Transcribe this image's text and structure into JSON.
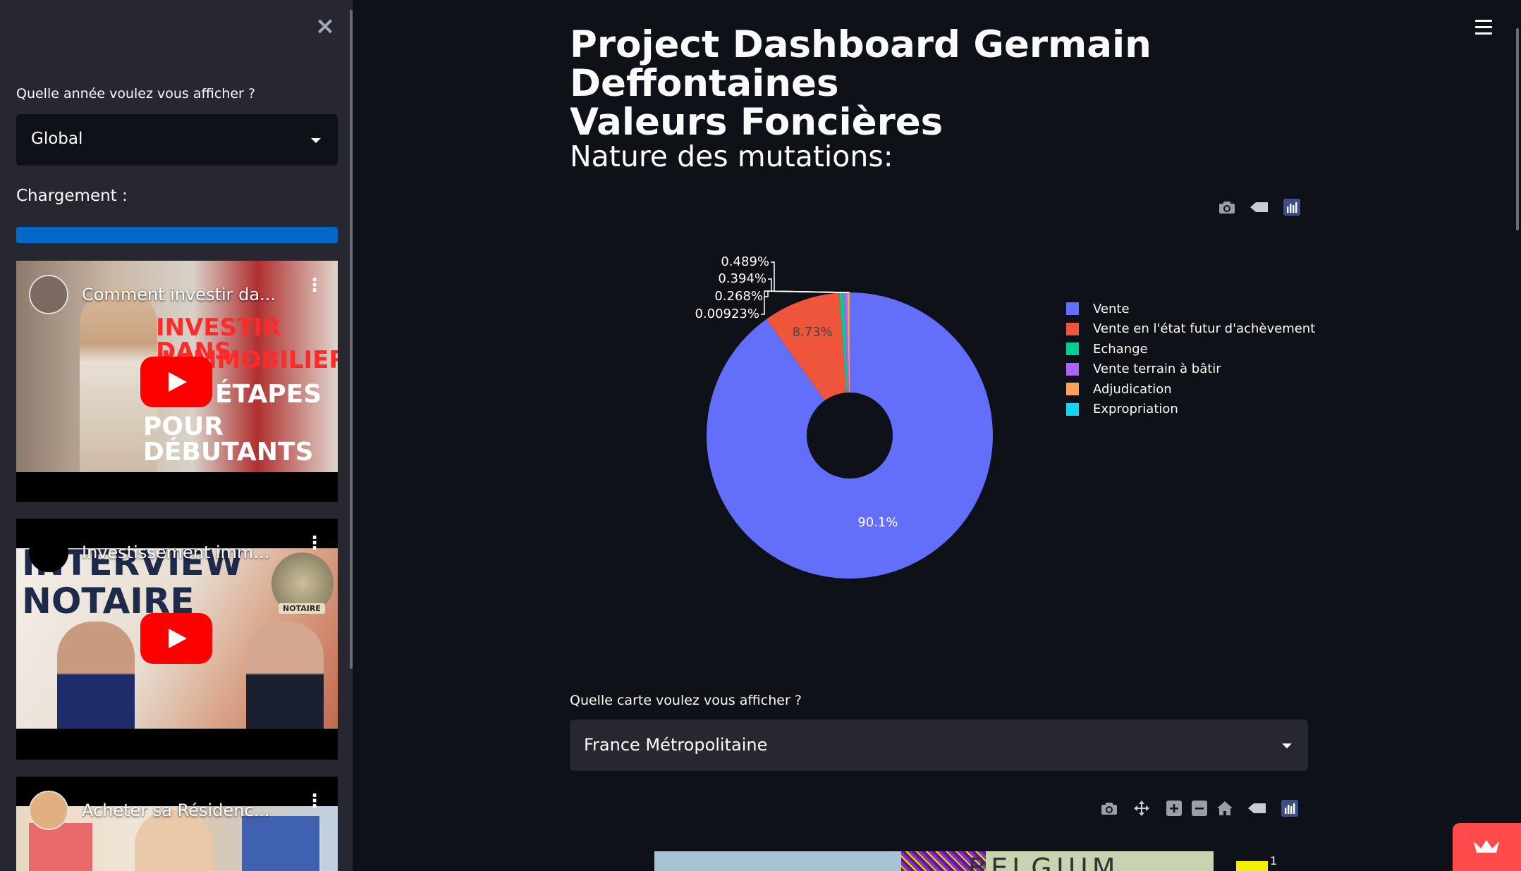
{
  "sidebar": {
    "close_icon": "close-icon",
    "year_label": "Quelle année voulez vous afficher ?",
    "year_value": "Global",
    "loading_label": "Chargement :",
    "loading_progress": 1.0,
    "videos": [
      {
        "title": "Comment investir da...",
        "overlay_lines": [
          "INVESTIR DANS",
          "L'IMMOBILIER",
          "ÉTAPES",
          "POUR DÉBUTANTS"
        ]
      },
      {
        "title": "Investissement imm...",
        "overlay_lines": [
          "INTERVIEW",
          "NOTAIRE"
        ],
        "badge": "NOTAIRE"
      },
      {
        "title": "Acheter sa Résidenc..."
      }
    ]
  },
  "header": {
    "title_line1": "Project Dashboard Germain Deffontaines",
    "title_line2": "Valeurs Foncières",
    "menu_icon": "hamburger-menu-icon"
  },
  "pie_section": {
    "subtitle": "Nature des mutations:"
  },
  "chart_data": {
    "type": "pie",
    "hole": true,
    "categories": [
      "Vente",
      "Vente en l'état futur d'achèvement",
      "Echange",
      "Vente terrain à bâtir",
      "Adjudication",
      "Expropriation"
    ],
    "values": [
      90.1,
      8.73,
      0.489,
      0.394,
      0.268,
      0.00923
    ],
    "labels": [
      "90.1%",
      "8.73%",
      "0.489%",
      "0.394%",
      "0.268%",
      "0.00923%"
    ],
    "colors": [
      "#636efa",
      "#ef553b",
      "#00cc96",
      "#ab63fa",
      "#ffa15a",
      "#19d3f3"
    ],
    "legend_position": "right"
  },
  "map_section": {
    "label": "Quelle carte voulez vous afficher ?",
    "value": "France Métropolitaine",
    "map_text": "BELGIUM",
    "colorbar_tick": "1"
  }
}
